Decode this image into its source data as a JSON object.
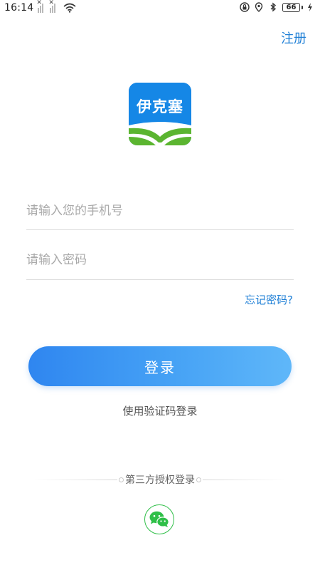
{
  "status_bar": {
    "time": "16:14",
    "battery_level": "66"
  },
  "header": {
    "register_label": "注册"
  },
  "logo": {
    "text": "伊克塞"
  },
  "form": {
    "phone_placeholder": "请输入您的手机号",
    "phone_value": "",
    "password_placeholder": "请输入密码",
    "password_value": "",
    "forgot_password_label": "忘记密码?",
    "login_label": "登录",
    "code_login_label": "使用验证码登录"
  },
  "third_party": {
    "title": "第三方授权登录",
    "providers": [
      {
        "icon": "wechat-icon"
      }
    ]
  },
  "colors": {
    "accent": "#1e7fd6",
    "button_gradient_start": "#2f86f0",
    "button_gradient_end": "#5fb7f9",
    "logo_blue": "#1587e6",
    "logo_green": "#5bb530",
    "wechat_green": "#2fbf48"
  }
}
